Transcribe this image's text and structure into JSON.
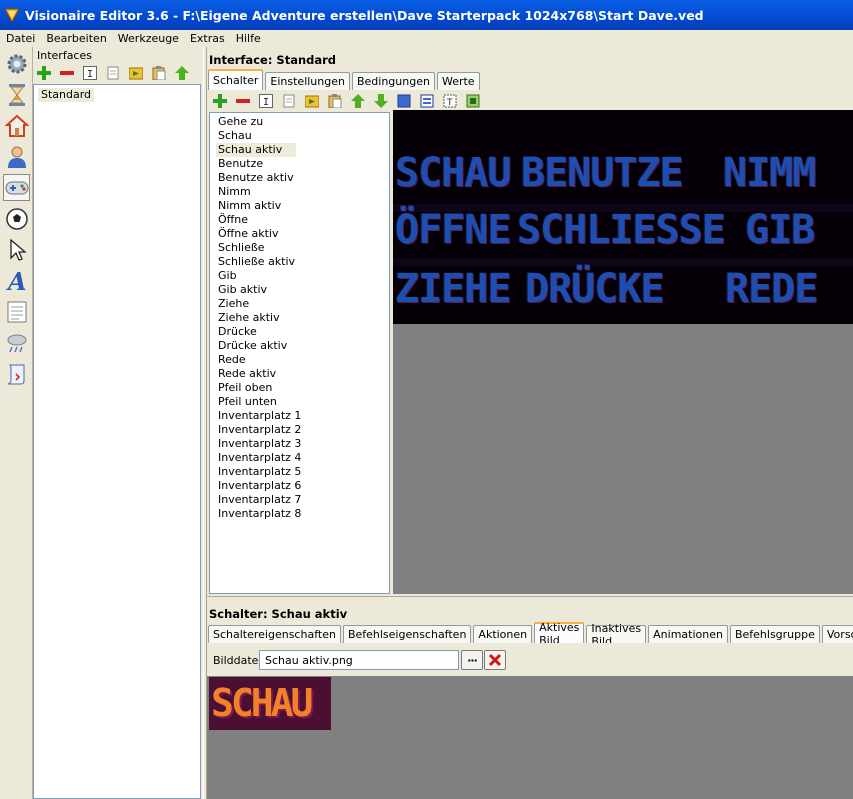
{
  "window": {
    "title": "Visionaire Editor 3.6 - F:\\Eigene Adventure erstellen\\Dave Starterpack 1024x768\\Start Dave.ved"
  },
  "menu": [
    "Datei",
    "Bearbeiten",
    "Werkzeuge",
    "Extras",
    "Hilfe"
  ],
  "left_toolbar": [
    "gear-icon",
    "hourglass-icon",
    "home-icon",
    "person-icon",
    "gamepad-icon",
    "ball-icon",
    "cursor-icon",
    "font-icon",
    "text-icon",
    "weather-icon",
    "script-icon"
  ],
  "interfaces_panel": {
    "title": "Interfaces",
    "items": [
      "Standard"
    ]
  },
  "interface_section": {
    "title": "Interface: Standard",
    "tabs": [
      "Schalter",
      "Einstellungen",
      "Bedingungen",
      "Werte"
    ],
    "active_tab": "Schalter"
  },
  "buttons_list": [
    "Gehe zu",
    "Schau",
    "Schau aktiv",
    "Benutze",
    "Benutze aktiv",
    "Nimm",
    "Nimm aktiv",
    "Öffne",
    "Öffne aktiv",
    "Schließe",
    "Schließe aktiv",
    "Gib",
    "Gib aktiv",
    "Ziehe",
    "Ziehe aktiv",
    "Drücke",
    "Drücke aktiv",
    "Rede",
    "Rede aktiv",
    "Pfeil oben",
    "Pfeil unten",
    "Inventarplatz 1",
    "Inventarplatz 2",
    "Inventarplatz 3",
    "Inventarplatz 4",
    "Inventarplatz 5",
    "Inventarplatz 6",
    "Inventarplatz 7",
    "Inventarplatz 8"
  ],
  "selected_button": "Schau aktiv",
  "sprite_words": {
    "row1": [
      "SCHAU",
      "BENUTZE",
      "NIMM"
    ],
    "row2": [
      "ÖFFNE",
      "SCHLIESSE",
      "GIB"
    ],
    "row3": [
      "ZIEHE",
      "DRÜCKE",
      "REDE"
    ]
  },
  "colors": {
    "sprite_text": "#1e4fb0",
    "active_image_text": "#f3812a",
    "active_tab_accent": "#f9b03c"
  },
  "schalter_section": {
    "title": "Schalter: Schau aktiv",
    "tabs": [
      "Schaltereigenschaften",
      "Befehlseigenschaften",
      "Aktionen",
      "Aktives Bild",
      "Inaktives Bild",
      "Animationen",
      "Befehlsgruppe",
      "Vorschau"
    ],
    "active_tab": "Aktives Bild"
  },
  "bilddatei": {
    "label": "Bilddatei",
    "value": "Schau aktiv.png",
    "browse_label": "···"
  },
  "active_image_text": "SCHAU"
}
